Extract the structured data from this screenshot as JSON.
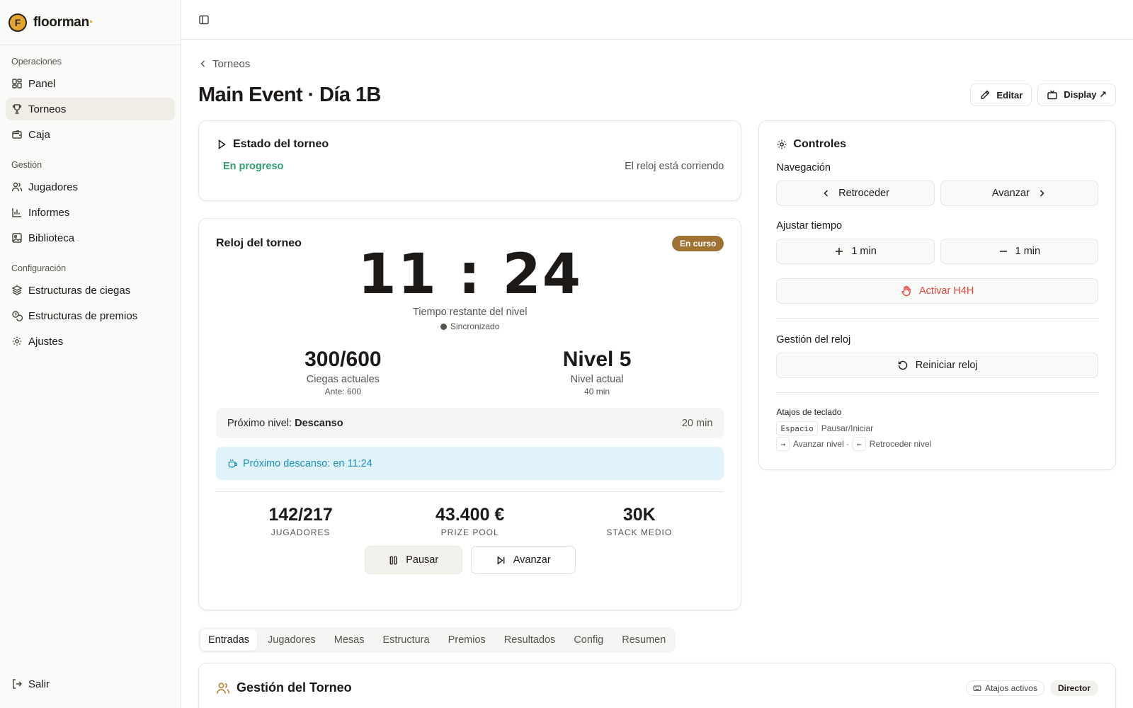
{
  "brand": {
    "name": "floorman",
    "logo_letter": "F"
  },
  "sidebar": {
    "groups": [
      {
        "heading": "Operaciones",
        "items": [
          {
            "label": "Panel",
            "icon": "dashboard-icon"
          },
          {
            "label": "Torneos",
            "icon": "trophy-icon",
            "active": true
          },
          {
            "label": "Caja",
            "icon": "wallet-icon"
          }
        ]
      },
      {
        "heading": "Gestión",
        "items": [
          {
            "label": "Jugadores",
            "icon": "users-icon"
          },
          {
            "label": "Informes",
            "icon": "bar-chart-icon"
          },
          {
            "label": "Biblioteca",
            "icon": "image-icon"
          }
        ]
      },
      {
        "heading": "Configuración",
        "items": [
          {
            "label": "Estructuras de ciegas",
            "icon": "layers-icon"
          },
          {
            "label": "Estructuras de premios",
            "icon": "coins-icon"
          },
          {
            "label": "Ajustes",
            "icon": "gear-icon"
          }
        ]
      }
    ],
    "logout_label": "Salir"
  },
  "breadcrumb": {
    "label": "Torneos"
  },
  "page": {
    "title": "Main Event · Día 1B",
    "edit_label": "Editar",
    "display_label": "Display ↗"
  },
  "status": {
    "title": "Estado del torneo",
    "state": "En progreso",
    "note": "El reloj está corriendo"
  },
  "clock": {
    "title": "Reloj del torneo",
    "badge": "En curso",
    "time": "11 : 24",
    "time_label": "Tiempo restante del nivel",
    "sync_label": "Sincronizado",
    "blinds": "300/600",
    "blinds_label": "Ciegas actuales",
    "ante": "Ante: 600",
    "level": "Nivel 5",
    "level_label": "Nivel actual",
    "level_duration": "40 min",
    "next_prefix": "Próximo nivel: ",
    "next_name": "Descanso",
    "next_duration": "20 min",
    "break_info": "Próximo descanso: en 11:24",
    "players": "142/217",
    "players_label": "Jugadores",
    "prize_pool": "43.400 €",
    "prize_pool_label": "Prize Pool",
    "avg_stack": "30K",
    "avg_stack_label": "Stack medio",
    "pause_label": "Pausar",
    "advance_label": "Avanzar"
  },
  "controls": {
    "title": "Controles",
    "nav_label": "Navegación",
    "back_label": "Retroceder",
    "forward_label": "Avanzar",
    "adjust_label": "Ajustar tiempo",
    "plus_label": "1 min",
    "minus_label": "1 min",
    "h4h_label": "Activar H4H",
    "clock_mgmt_label": "Gestión del reloj",
    "reset_label": "Reiniciar reloj",
    "shortcuts_title": "Atajos de teclado",
    "key_space": "Espacio",
    "key_space_desc": "Pausar/Iniciar",
    "key_right": "→",
    "key_right_desc": "Avanzar nivel ·",
    "key_left": "←",
    "key_left_desc": "Retroceder nivel"
  },
  "tabs": [
    "Entradas",
    "Jugadores",
    "Mesas",
    "Estructura",
    "Premios",
    "Resultados",
    "Config",
    "Resumen"
  ],
  "management": {
    "title": "Gestión del Torneo",
    "shortcuts_badge": "Atajos activos",
    "role_badge": "Director"
  },
  "colors": {
    "accent_gold": "#a07334",
    "status_green": "#2f9e6b",
    "danger_red": "#e0453a",
    "info_blue": "#1590b8"
  }
}
